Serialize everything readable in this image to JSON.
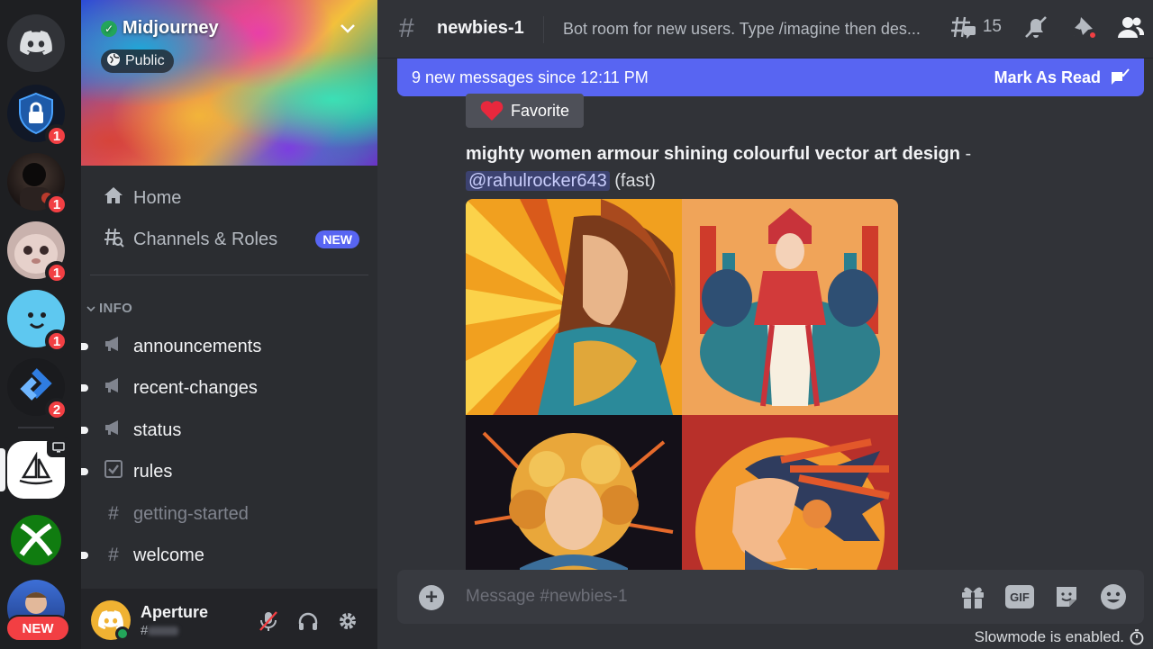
{
  "rail": {
    "servers": [
      {
        "name": "discord-home",
        "badge": ""
      },
      {
        "name": "security-server",
        "badge": "1"
      },
      {
        "name": "dark-avatar-server",
        "badge": "1"
      },
      {
        "name": "cat-avatar-server",
        "badge": "1"
      },
      {
        "name": "blue-face-server",
        "badge": "1"
      },
      {
        "name": "arrow-server",
        "badge": "2"
      },
      {
        "name": "midjourney-server",
        "badge": ""
      },
      {
        "name": "xbox-server",
        "badge": ""
      },
      {
        "name": "person-server",
        "badge": ""
      }
    ],
    "new_label": "NEW"
  },
  "server": {
    "name": "Midjourney",
    "visibility": "Public"
  },
  "nav": {
    "home": "Home",
    "channels_roles": "Channels & Roles",
    "new_tag": "NEW"
  },
  "category": "INFO",
  "channels": [
    {
      "name": "announcements",
      "icon": "megaphone-icon"
    },
    {
      "name": "recent-changes",
      "icon": "megaphone-icon"
    },
    {
      "name": "status",
      "icon": "megaphone-icon"
    },
    {
      "name": "rules",
      "icon": "checkbox-icon"
    },
    {
      "name": "getting-started",
      "icon": "hash-icon"
    },
    {
      "name": "welcome",
      "icon": "hash-icon"
    }
  ],
  "user": {
    "name": "Aperture",
    "tag": "#"
  },
  "header": {
    "channel": "newbies-1",
    "topic": "Bot room for new users. Type /imagine then des...",
    "threads_count": "15"
  },
  "new_messages": {
    "text": "9 new messages since 12:11 PM",
    "mark_read": "Mark As Read"
  },
  "message": {
    "favorite": "Favorite",
    "prompt": "mighty women armour shining colourful vector art design",
    "dash": " - ",
    "mention": "@rahulrocker643",
    "speed": " (fast)"
  },
  "composer": {
    "placeholder": "Message #newbies-1",
    "gif": "GIF"
  },
  "slowmode": "Slowmode is enabled.",
  "colors": {
    "blurple": "#5865f2",
    "red": "#f23f43",
    "green": "#23a55a"
  }
}
